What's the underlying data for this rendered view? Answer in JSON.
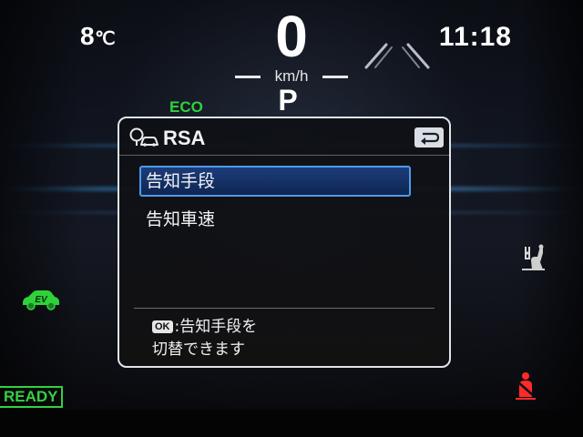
{
  "status": {
    "temperature": "8",
    "temperature_unit": "℃",
    "time": "11:18",
    "speed": "0",
    "speed_unit": "km/h",
    "gear": "P",
    "eco_label": "ECO",
    "ready_label": "READY",
    "ev_label": "EV"
  },
  "panel": {
    "title": "RSA",
    "icons": {
      "header": "road-sign-car-icon",
      "back": "return-arrow-icon"
    },
    "menu_items": [
      {
        "label": "告知手段",
        "selected": true
      },
      {
        "label": "告知車速",
        "selected": false
      }
    ],
    "hint": {
      "badge": "OK",
      "line1": ":告知手段を",
      "line2": "切替できます"
    }
  },
  "indicators": {
    "lane_icon": "lane-departure-icon",
    "seat_icon": "seat-position-icon",
    "belt_icon": "seatbelt-warning-icon",
    "ev_color": "#34d13e",
    "eco_color": "#2fd23a",
    "warning_color": "#ff2a2a"
  }
}
